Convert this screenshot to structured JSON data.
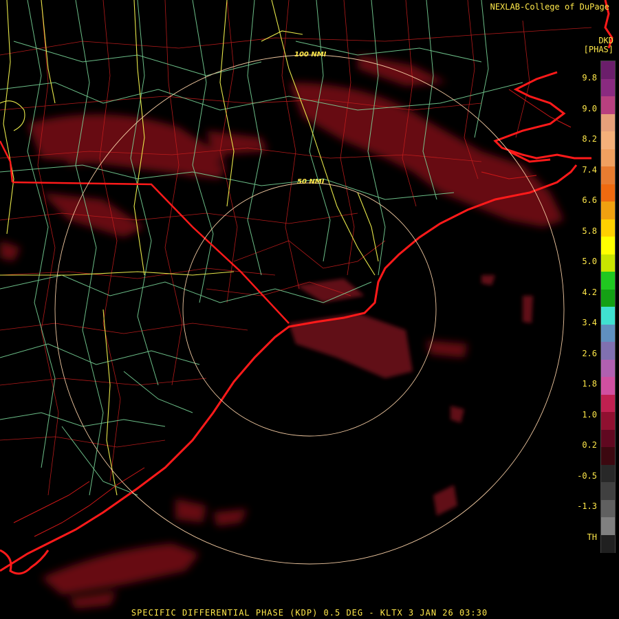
{
  "credit": "NEXLAB-College of DuPage",
  "product": {
    "code": "DKD",
    "units": "[PHAS]"
  },
  "range_rings": [
    {
      "label": "100 NMI"
    },
    {
      "label": "50 NMI"
    }
  ],
  "colorbar": {
    "labels": [
      "9.8",
      "9.0",
      "8.2",
      "7.4",
      "6.6",
      "5.8",
      "5.0",
      "4.2",
      "3.4",
      "2.6",
      "1.8",
      "1.0",
      "0.2",
      "-0.5",
      "-1.3",
      "TH"
    ],
    "colors": [
      "#6b1e6b",
      "#8a2a80",
      "#b8407f",
      "#e7a07a",
      "#f4b07a",
      "#f0a060",
      "#e87c30",
      "#ef6a10",
      "#f0a010",
      "#ffd000",
      "#ffff00",
      "#c8e400",
      "#20c820",
      "#14a014",
      "#40e0d0",
      "#6090c0",
      "#8070b0",
      "#b060b0",
      "#d050a0",
      "#c02050",
      "#901030",
      "#600820",
      "#3c0810",
      "#282828",
      "#404040",
      "#606060",
      "#808080",
      "#202020"
    ],
    "color_tags": {
      "top": "purple",
      "mid_high": "orange",
      "mid": "yellow-green",
      "low": "cyan-magenta",
      "lower": "dark-red",
      "bottom": "gray"
    }
  },
  "footer": "SPECIFIC DIFFERENTIAL PHASE (KDP) 0.5 DEG - KLTX 3 JAN 26 03:30",
  "colors": {
    "text": "#ffe84a",
    "coast": "#ff1a1a",
    "county": "#c81e1e",
    "highway_major": "#e8e84a",
    "highway_minor": "#7fe0a0",
    "ring": "#f0c8a0",
    "echo": "#7a0e18"
  }
}
